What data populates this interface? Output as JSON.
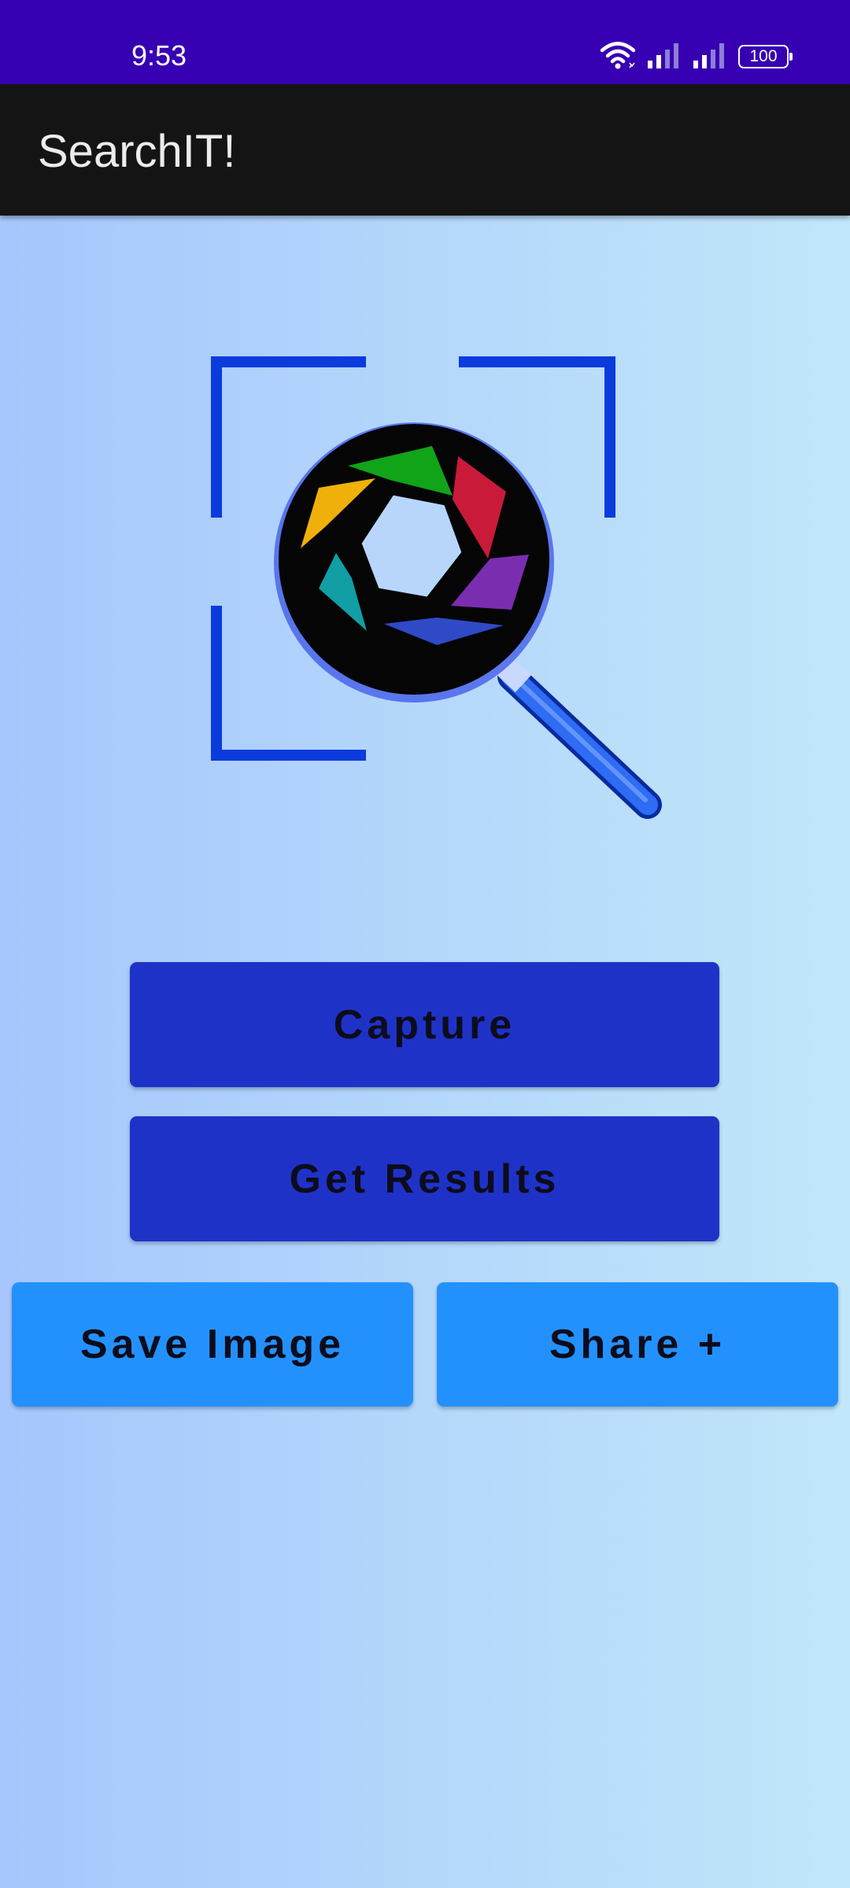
{
  "status_bar": {
    "time": "9:53",
    "battery": "100",
    "background_color": "#3700b3",
    "icons": [
      "wifi-icon",
      "signal-icon",
      "signal-icon",
      "battery-icon"
    ]
  },
  "app_bar": {
    "title": "SearchIT!",
    "background_color": "#141414"
  },
  "logo": {
    "icon": "camera-aperture-magnifier-icon"
  },
  "buttons": {
    "capture": "Capture",
    "get_results": "Get Results",
    "save_image": "Save Image",
    "share": "Share +"
  },
  "colors": {
    "primary_button": "#1f32c8",
    "secondary_button": "#2391fd"
  }
}
